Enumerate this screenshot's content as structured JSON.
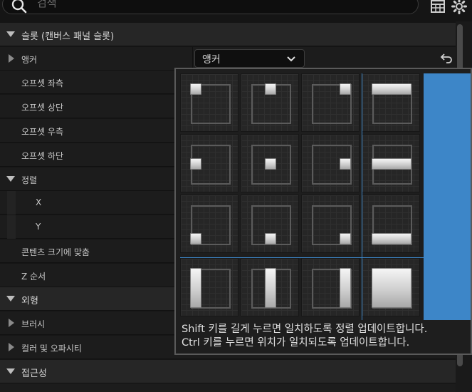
{
  "search": {
    "placeholder": "검색"
  },
  "toolbar": {
    "table_icon": "table-icon",
    "settings_icon": "gear-icon"
  },
  "categories": {
    "slot": "슬롯 (캔버스 패널 슬롯)",
    "appearance": "외형",
    "accessibility": "접근성"
  },
  "rows": {
    "anchor": "앵커",
    "offset_left": "오프셋 좌측",
    "offset_top": "오프셋 상단",
    "offset_right": "오프셋 우측",
    "offset_bottom": "오프셋 하단",
    "alignment": "정렬",
    "align_x": "X",
    "align_y": "Y",
    "size_to_content": "콘텐츠 크기에 맞춤",
    "z_order": "Z 순서",
    "brush": "브러시",
    "color_opacity": "컬러 및 오파시티"
  },
  "anchor_dropdown": {
    "value": "앵커"
  },
  "anchor_popup": {
    "hint_line1": "Shift 키를 길게 누르면 일치하도록 정렬 업데이트합니다.",
    "hint_line2": "Ctrl 키를 누르면 위치가 일치되도록 업데이트합니다.",
    "selected": "fill",
    "accent_color": "#3d86c8"
  }
}
